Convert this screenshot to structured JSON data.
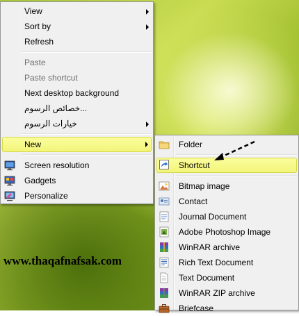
{
  "context_menu": {
    "items": [
      {
        "label": "View",
        "submenu": true
      },
      {
        "label": "Sort by",
        "submenu": true
      },
      {
        "label": "Refresh"
      },
      {
        "label": "Paste",
        "disabled": true
      },
      {
        "label": "Paste shortcut",
        "disabled": true
      },
      {
        "label": "Next desktop background"
      },
      {
        "label": "خصائص الرسوم..."
      },
      {
        "label": "خيارات الرسوم",
        "submenu": true
      },
      {
        "label": "New",
        "submenu": true,
        "highlighted": true
      },
      {
        "label": "Screen resolution",
        "icon": "screen-resolution-icon"
      },
      {
        "label": "Gadgets",
        "icon": "gadgets-icon"
      },
      {
        "label": "Personalize",
        "icon": "personalize-icon"
      }
    ]
  },
  "new_submenu": {
    "items": [
      {
        "label": "Folder",
        "icon": "folder-icon"
      },
      {
        "label": "Shortcut",
        "icon": "shortcut-icon",
        "highlighted": true
      },
      {
        "label": "Bitmap image",
        "icon": "bitmap-image-icon"
      },
      {
        "label": "Contact",
        "icon": "contact-icon"
      },
      {
        "label": "Journal Document",
        "icon": "journal-document-icon"
      },
      {
        "label": "Adobe Photoshop Image",
        "icon": "photoshop-image-icon"
      },
      {
        "label": "WinRAR archive",
        "icon": "winrar-archive-icon"
      },
      {
        "label": "Rich Text Document",
        "icon": "rich-text-document-icon"
      },
      {
        "label": "Text Document",
        "icon": "text-document-icon"
      },
      {
        "label": "WinRAR ZIP archive",
        "icon": "winrar-zip-archive-icon"
      },
      {
        "label": "Briefcase",
        "icon": "briefcase-icon"
      }
    ]
  },
  "watermark": "www.thaqafnafsak.com",
  "colors": {
    "highlight": "#f6f88a",
    "menu_bg": "#f0f0f0"
  }
}
